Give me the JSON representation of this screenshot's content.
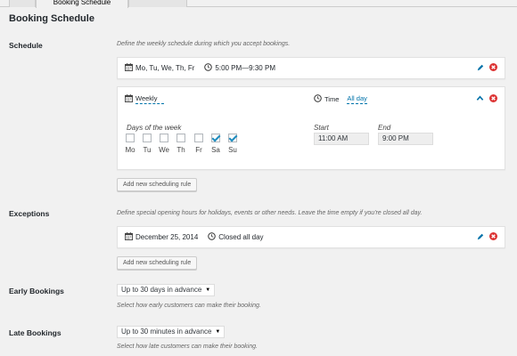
{
  "tabs": [
    {
      "label": ""
    },
    {
      "label": "Booking Schedule"
    },
    {
      "label": ""
    }
  ],
  "section_title": "Booking Schedule",
  "schedule": {
    "label": "Schedule",
    "description": "Define the weekly schedule during which you accept bookings.",
    "rule1": {
      "days_text": "Mo, Tu, We, Th, Fr",
      "time_text": "5:00 PM—9:30 PM"
    },
    "rule2": {
      "frequency": "Weekly",
      "time_label": "Time",
      "time_value": "All day",
      "days_label": "Days of the week",
      "days": [
        {
          "name": "Mo",
          "checked": false
        },
        {
          "name": "Tu",
          "checked": false
        },
        {
          "name": "We",
          "checked": false
        },
        {
          "name": "Th",
          "checked": false
        },
        {
          "name": "Fr",
          "checked": false
        },
        {
          "name": "Sa",
          "checked": true
        },
        {
          "name": "Su",
          "checked": true
        }
      ],
      "start_label": "Start",
      "start_value": "11:00 AM",
      "end_label": "End",
      "end_value": "9:00 PM"
    },
    "add_button": "Add new scheduling rule"
  },
  "exceptions": {
    "label": "Exceptions",
    "description": "Define special opening hours for holidays, events or other needs. Leave the time empty if you're closed all day.",
    "rule": {
      "date_text": "December 25, 2014",
      "time_text": "Closed all day"
    },
    "add_button": "Add new scheduling rule"
  },
  "early": {
    "label": "Early Bookings",
    "value": "Up to 30 days in advance",
    "description": "Select how early customers can make their booking."
  },
  "late": {
    "label": "Late Bookings",
    "value": "Up to 30 minutes in advance",
    "description": "Select how late customers can make their booking."
  },
  "colors": {
    "link": "#0073aa",
    "delete": "#dc3232",
    "background": "#f1f1f1"
  }
}
